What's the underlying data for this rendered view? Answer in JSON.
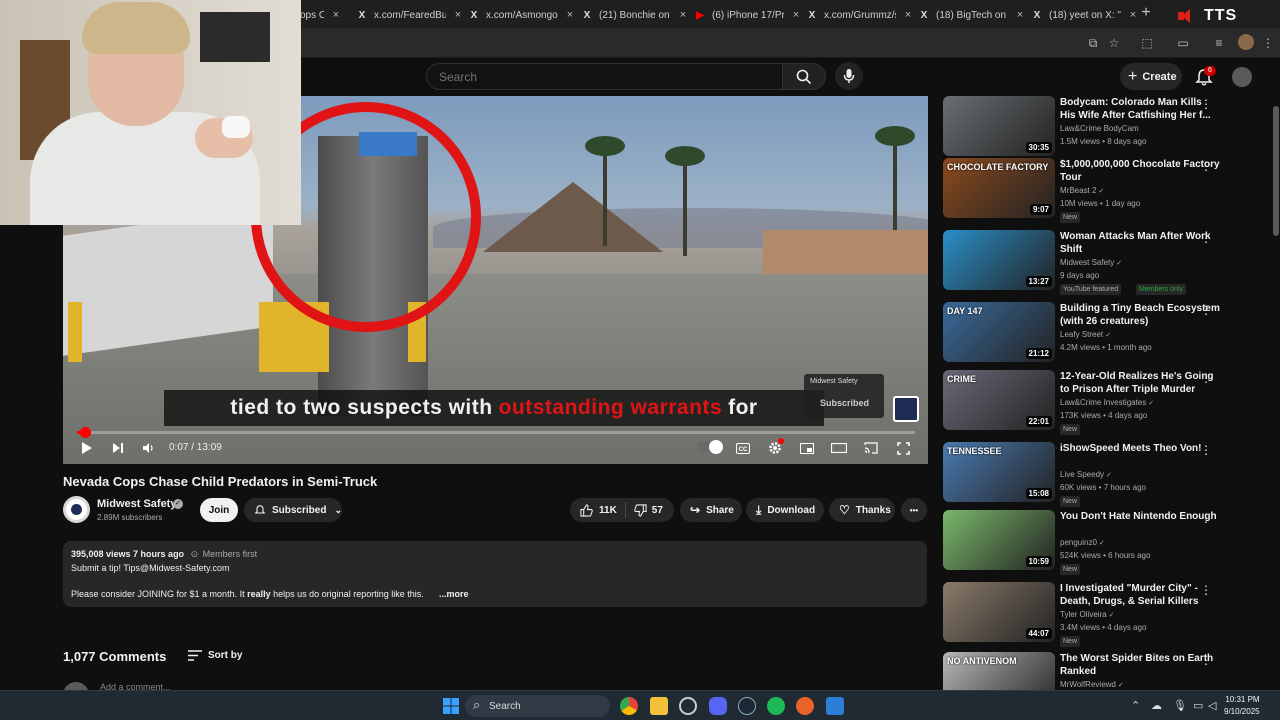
{
  "browser": {
    "tabs": [
      {
        "label": "ops C",
        "icon": "youtube-icon"
      },
      {
        "label": "x.com/FearedBuck",
        "icon": "x-icon"
      },
      {
        "label": "x.com/Asmongold",
        "icon": "x-icon"
      },
      {
        "label": "(21) Bonchie on X",
        "icon": "x-icon"
      },
      {
        "label": "(6) iPhone 17/Pro",
        "icon": "youtube-icon"
      },
      {
        "label": "x.com/Grummz/st",
        "icon": "x-icon"
      },
      {
        "label": "(18) BigTech on X",
        "icon": "x-icon"
      },
      {
        "label": "(18) yeet on X: \"H",
        "icon": "x-icon"
      }
    ],
    "tab_close": "×",
    "new_tab": "+",
    "overlay_badge": "TTS"
  },
  "header": {
    "search_placeholder": "Search",
    "create_label": "Create",
    "notification_count": "6"
  },
  "player": {
    "caption_before": "tied to two suspects with",
    "caption_highlight": "outstanding warrants",
    "caption_after": "for",
    "end_card_channel": "Midwest Safety",
    "end_card_status": "Subscribed",
    "time": "0:07 / 13:09",
    "progress_fraction": 0.009
  },
  "video": {
    "title": "Nevada Cops Chase Child Predators in Semi-Truck",
    "channel": "Midwest Safety",
    "subscribers": "2.89M subscribers",
    "join_label": "Join",
    "subscribed_label": "Subscribed",
    "likes": "11K",
    "dislikes": "57",
    "share_label": "Share",
    "download_label": "Download",
    "thanks_label": "Thanks",
    "more_label": "•••"
  },
  "description": {
    "views_time": "395,008 views  7 hours ago",
    "members_first": "Members first",
    "line1": "Submit a tip! Tips@Midwest-Safety.com",
    "line2_a": "Please consider JOINING for $1 a month. It",
    "line2_bold": "really",
    "line2_b": "helps us do original reporting like this.",
    "more": "...more"
  },
  "comments": {
    "count_label": "1,077 Comments",
    "sort_label": "Sort by",
    "add_placeholder": "Add a comment..."
  },
  "recommendations": [
    {
      "title": "Bodycam: Colorado Man Kills His Wife After Catfishing Her f...",
      "channel": "Law&Crime BodyCam",
      "stats": "1.5M views • 8 days ago",
      "duration": "30:35",
      "badge": "",
      "badge2": "",
      "verified": false,
      "color": "#6a6f73"
    },
    {
      "title": "$1,000,000,000 Chocolate Factory Tour",
      "channel": "MrBeast 2",
      "stats": "10M views • 1 day ago",
      "duration": "9:07",
      "badge": "New",
      "badge2": "",
      "verified": true,
      "color": "#8a4a1e"
    },
    {
      "title": "Woman Attacks Man After Work Shift",
      "channel": "Midwest Safety",
      "stats": "9 days ago",
      "duration": "13:27",
      "badge": "YouTube featured",
      "badge2": "Members only",
      "verified": true,
      "color": "#2a8fc8"
    },
    {
      "title": "Building a Tiny Beach Ecosystem (with 26 creatures)",
      "channel": "Leafy Street",
      "stats": "4.2M views • 1 month ago",
      "duration": "21:12",
      "badge": "",
      "badge2": "",
      "verified": true,
      "color": "#3a6a9a"
    },
    {
      "title": "12-Year-Old Realizes He's Going to Prison After Triple Murder",
      "channel": "Law&Crime Investigates",
      "stats": "173K views • 4 days ago",
      "duration": "22:01",
      "badge": "New",
      "badge2": "",
      "verified": true,
      "color": "#6a6a78"
    },
    {
      "title": "iShowSpeed Meets Theo Von!",
      "channel": "Live Speedy",
      "stats": "60K views • 7 hours ago",
      "duration": "15:08",
      "badge": "New",
      "badge2": "",
      "verified": true,
      "color": "#4a7ab0"
    },
    {
      "title": "You Don't Hate Nintendo Enough",
      "channel": "penguinz0",
      "stats": "524K views • 6 hours ago",
      "duration": "10:59",
      "badge": "New",
      "badge2": "",
      "verified": true,
      "color": "#7ab86a"
    },
    {
      "title": "I Investigated \"Murder City\" - Death, Drugs, & Serial Killers",
      "channel": "Tyler Oliveira",
      "stats": "3.4M views • 4 days ago",
      "duration": "44:07",
      "badge": "New",
      "badge2": "",
      "verified": true,
      "color": "#8a7a6a"
    },
    {
      "title": "The Worst Spider Bites on Earth Ranked",
      "channel": "MrWolfReviewd",
      "stats": "",
      "duration": "",
      "badge": "",
      "badge2": "",
      "verified": true,
      "color": "#b8b8b8"
    }
  ],
  "thumb_text": {
    "chocolate": "CHOCOLATE FACTORY",
    "day": "DAY 147",
    "crime": "CRIME",
    "tennessee": "TENNESSEE",
    "antivenom": "NO ANTIVENOM"
  },
  "taskbar": {
    "search_label": "Search",
    "time": "10:31 PM",
    "date": "9/10/2025"
  }
}
